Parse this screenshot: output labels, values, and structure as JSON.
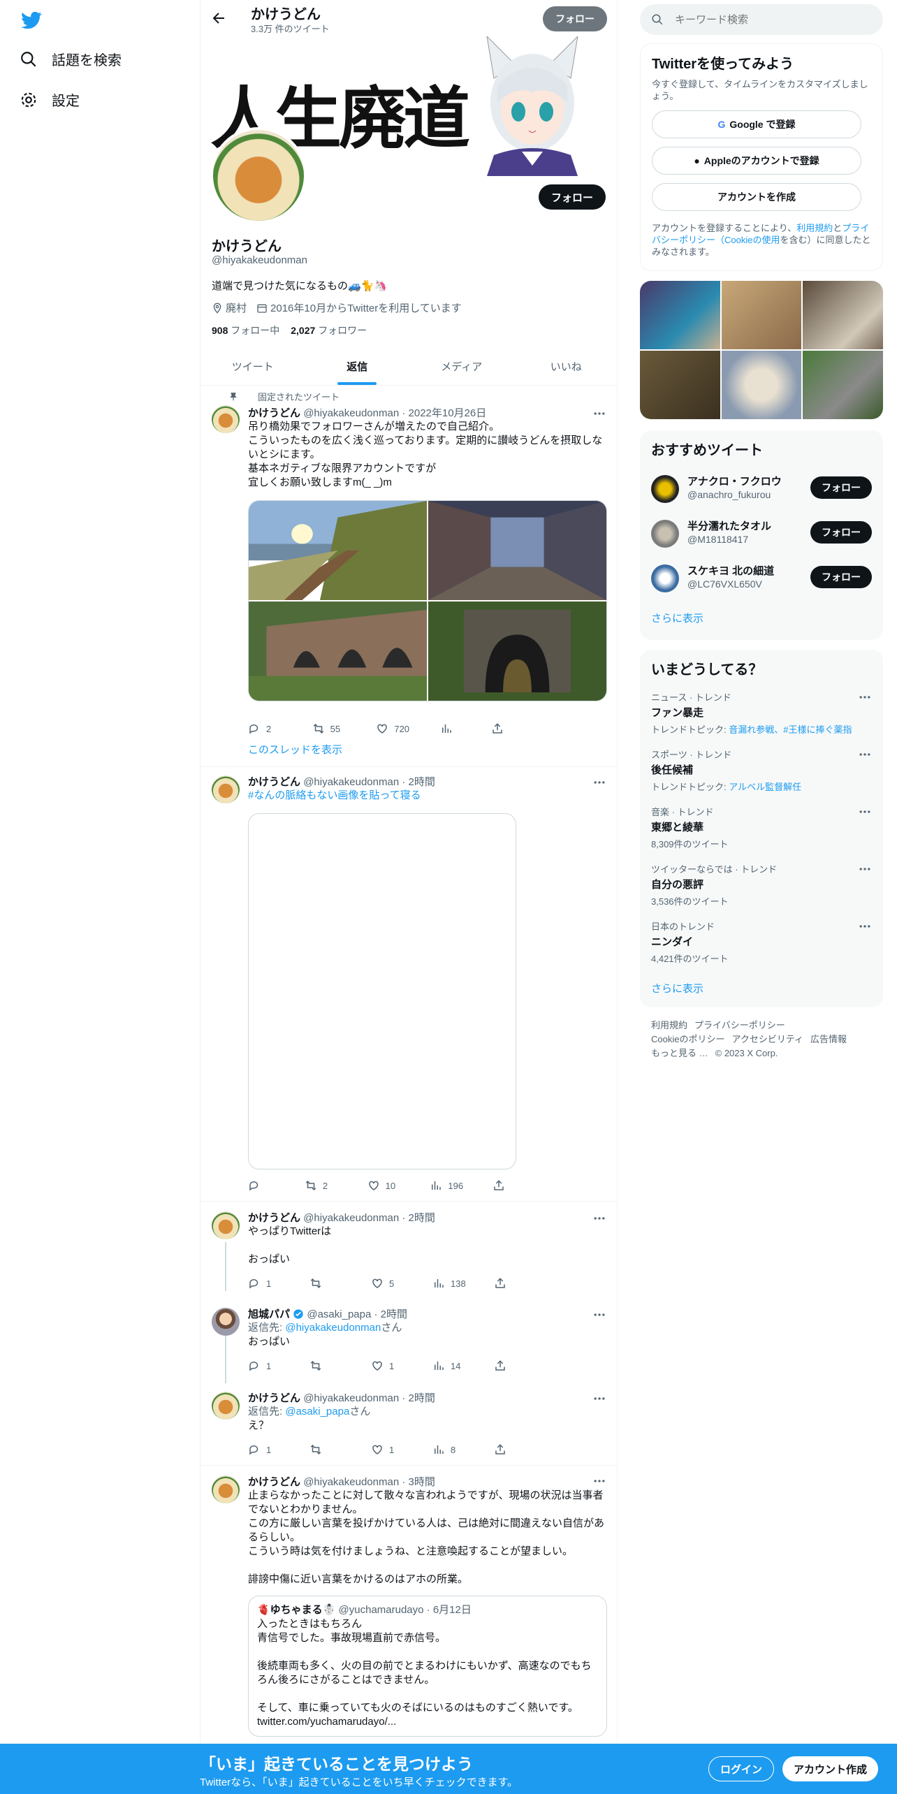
{
  "left_nav": {
    "explore": "話題を検索",
    "settings": "設定"
  },
  "topbar": {
    "name": "かけうどん",
    "tweet_count": "3.3万 件のツイート",
    "follow": "フォロー"
  },
  "banner_text": "人生廃道",
  "profile": {
    "name": "かけうどん",
    "handle": "@hiyakakeudonman",
    "bio": "道端で見つけた気になるもの🚙🐈🦄",
    "location": "廃村",
    "joined": "2016年10月からTwitterを利用しています",
    "following_count": "908",
    "following_label": "フォロー中",
    "followers_count": "2,027",
    "followers_label": "フォロワー",
    "follow": "フォロー"
  },
  "tabs": [
    "ツイート",
    "返信",
    "メディア",
    "いいね"
  ],
  "tweets": {
    "pinned_label": "固定されたツイート",
    "t1": {
      "name": "かけうどん",
      "handle": "@hiyakakeudonman",
      "time": "· 2022年10月26日",
      "text": "吊り橋効果でフォロワーさんが増えたので自己紹介。\nこういったものを広く浅く巡っております。定期的に讃岐うどんを摂取しないとシにます。\n基本ネガティブな限界アカウントですが\n宜しくお願い致しますm(_ _)m",
      "replies": "2",
      "retweets": "55",
      "likes": "720",
      "thread_link": "このスレッドを表示"
    },
    "t2": {
      "name": "かけうどん",
      "handle": "@hiyakakeudonman",
      "time": "· 2時間",
      "text": "#なんの脈絡もない画像を貼って寝る",
      "replies": "",
      "retweets": "2",
      "likes": "10",
      "views": "196"
    },
    "t3": {
      "name": "かけうどん",
      "handle": "@hiyakakeudonman",
      "time": "· 2時間",
      "text": "やっぱりTwitterは\n\nおっぱい",
      "replies": "1",
      "retweets": "",
      "likes": "5",
      "views": "138"
    },
    "t4": {
      "name": "旭城パパ",
      "handle": "@asaki_papa",
      "time": "· 2時間",
      "reply_to_label": "返信先: ",
      "reply_to": "@hiyakakeudonman",
      "reply_suffix": "さん",
      "text": "おっぱい",
      "replies": "1",
      "retweets": "",
      "likes": "1",
      "views": "14"
    },
    "t5": {
      "name": "かけうどん",
      "handle": "@hiyakakeudonman",
      "time": "· 2時間",
      "reply_to_label": "返信先: ",
      "reply_to": "@asaki_papa",
      "reply_suffix": "さん",
      "text": "え？",
      "replies": "1",
      "retweets": "",
      "likes": "1",
      "views": "8"
    },
    "t6": {
      "name": "かけうどん",
      "handle": "@hiyakakeudonman",
      "time": "· 3時間",
      "text": "止まらなかったことに対して散々な言われようですが、現場の状況は当事者でないとわかりません。\nこの方に厳しい言葉を投げかけている人は、己は絶対に間違えない自信があるらしい。\nこういう時は気を付けましょうね、と注意喚起することが望ましい。\n\n誹謗中傷に近い言葉をかけるのはアホの所業。",
      "quote": {
        "name": "🫀ゆちゃまる☃️",
        "handle": "@yuchamarudayo",
        "time": "· 6月12日",
        "text": "入ったときはもちろん\n青信号でした。事故現場直前で赤信号。\n\n後続車両も多く、火の目の前でとまるわけにもいかず、高速なのでもちろん後ろにさがることはできません。\n\nそして、車に乗っていても火のそばにいるのはものすごく熱いです。\ntwitter.com/yuchamarudayo/..."
      }
    }
  },
  "right": {
    "search_placeholder": "キーワード検索",
    "signup": {
      "title": "Twitterを使ってみよう",
      "subtitle": "今すぐ登録して、タイムラインをカスタマイズしましょう。",
      "google": "Google で登録",
      "apple": "Appleのアカウントで登録",
      "create": "アカウントを作成",
      "legal_1": "アカウントを登録することにより、",
      "legal_terms": "利用規約",
      "legal_2": "と",
      "legal_privacy": "プライバシーポリシー（Cookieの使用",
      "legal_3": "を含む）に同意したとみなされます。"
    },
    "recommend": {
      "title": "おすすめツイート",
      "users": [
        {
          "name": "アナクロ・フクロウ",
          "handle": "@anachro_fukurou",
          "follow": "フォロー"
        },
        {
          "name": "半分濡れたタオル",
          "handle": "@M18118417",
          "follow": "フォロー"
        },
        {
          "name": "スケキヨ 北の細道",
          "handle": "@LC76VXL650V",
          "follow": "フォロー"
        }
      ],
      "more": "さらに表示"
    },
    "trends": {
      "title": "いまどうしてる？",
      "items": [
        {
          "category": "ニュース · トレンド",
          "name": "ファン暴走",
          "sub_label": "トレンドトピック: ",
          "sub_link": "音漏れ参戦、#王様に捧ぐ薬指"
        },
        {
          "category": "スポーツ · トレンド",
          "name": "後任候補",
          "sub_label": "トレンドトピック: ",
          "sub_link": "アルベル監督解任"
        },
        {
          "category": "音楽 · トレンド",
          "name": "東郷と綾華",
          "sub_label": "8,309件のツイート",
          "sub_link": ""
        },
        {
          "category": "ツイッターならでは · トレンド",
          "name": "自分の悪評",
          "sub_label": "3,536件のツイート",
          "sub_link": ""
        },
        {
          "category": "日本のトレンド",
          "name": "ニンダイ",
          "sub_label": "4,421件のツイート",
          "sub_link": ""
        }
      ],
      "more": "さらに表示"
    },
    "footer": {
      "terms": "利用規約",
      "privacy": "プライバシーポリシー",
      "cookie": "Cookieのポリシー",
      "accessibility": "アクセシビリティ",
      "ads": "広告情報",
      "more": "もっと見る …",
      "copyright": "© 2023 X Corp."
    }
  },
  "bottom_bar": {
    "title": "「いま」起きていることを見つけよう",
    "subtitle": "Twitterなら、「いま」起きていることをいち早くチェックできます。",
    "login": "ログイン",
    "signup": "アカウント作成"
  },
  "colors": {
    "accent": "#1d9bf0",
    "text": "#0f1419",
    "muted": "#536471",
    "border": "#eff3f4"
  }
}
